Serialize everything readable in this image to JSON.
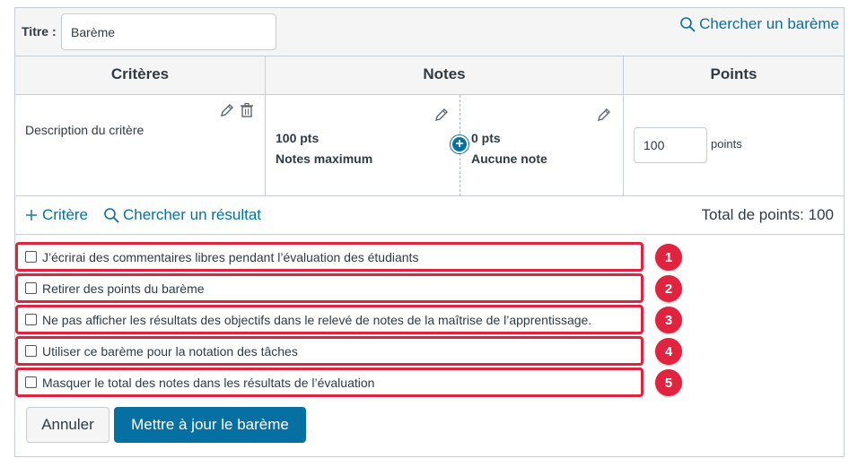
{
  "header": {
    "title_label": "Titre :",
    "title_value": "Barème",
    "find_rubric_link": "Chercher un barème",
    "accent_color": "#0770a3"
  },
  "table": {
    "columns": [
      "Critères",
      "Notes",
      "Points"
    ],
    "criterion": {
      "description": "Description du critère",
      "ratings": [
        {
          "points": "100 pts",
          "label": "Notes maximum"
        },
        {
          "points": "0 pts",
          "label": "Aucune note"
        }
      ],
      "points_value": "100",
      "points_unit": "points"
    },
    "footer": {
      "add_criterion": "Critère",
      "find_outcome": "Chercher un résultat",
      "total_points": "Total de points: 100"
    }
  },
  "options": [
    {
      "label": "J’écrirai des commentaires libres pendant l’évaluation des étudiants",
      "checked": false,
      "badge": "1"
    },
    {
      "label": "Retirer des points du barème",
      "checked": false,
      "badge": "2"
    },
    {
      "label": "Ne pas afficher les résultats des objectifs dans le relevé de notes de la maîtrise de l’apprentissage.",
      "checked": false,
      "badge": "3"
    },
    {
      "label": "Utiliser ce barème pour la notation des tâches",
      "checked": false,
      "badge": "4"
    },
    {
      "label": "Masquer le total des notes dans les résultats de l’évaluation",
      "checked": false,
      "badge": "5"
    }
  ],
  "highlight_color": "#e0233f",
  "buttons": {
    "cancel": "Annuler",
    "update": "Mettre à jour le barème"
  }
}
